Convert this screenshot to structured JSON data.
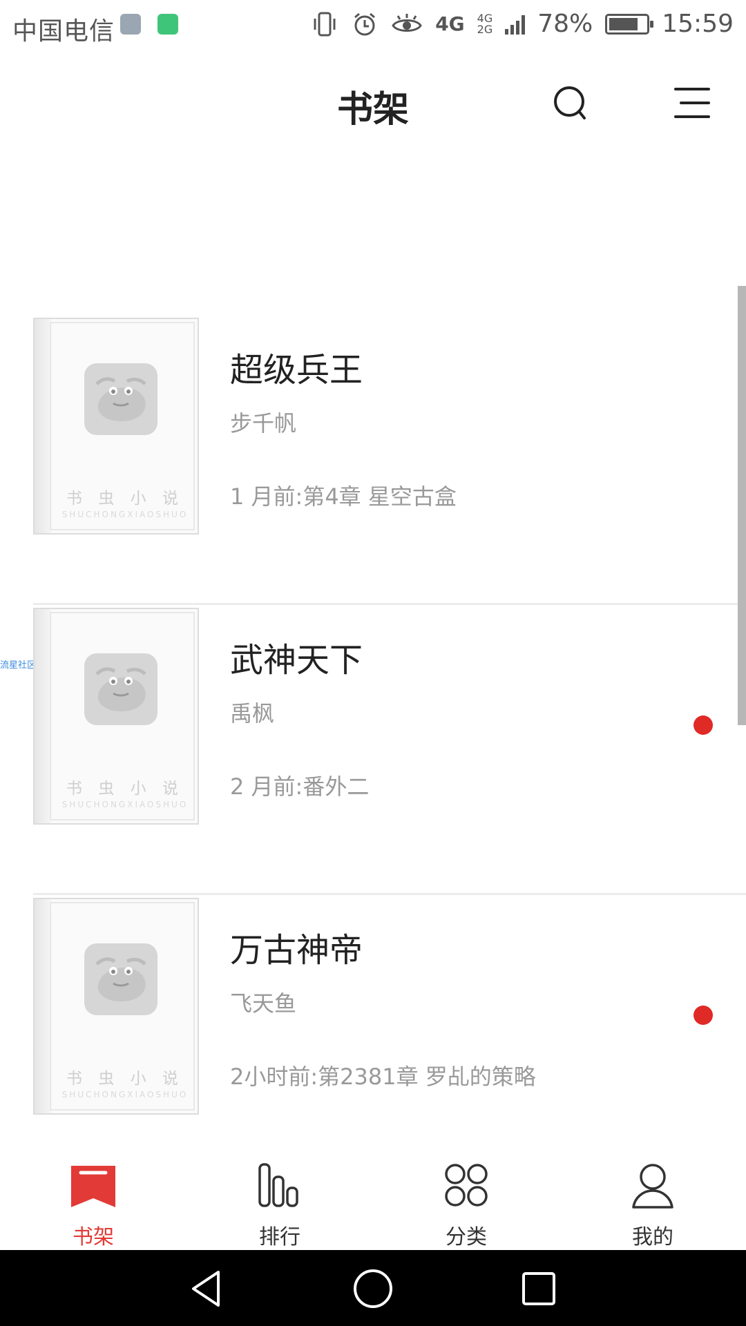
{
  "status_bar": {
    "carrier": "中国电信",
    "network_1": "4G",
    "network_2_top": "4G",
    "network_2_bottom": "2G",
    "battery_percent": "78%",
    "battery_level": 0.78,
    "time": "15:59"
  },
  "header": {
    "title": "书架",
    "search_icon": "search-icon",
    "menu_icon": "menu-icon"
  },
  "side_link": "流星社区",
  "cover": {
    "title_cn": "书 虫 小 说",
    "title_en": "SHUCHONGXIAOSHUO"
  },
  "books": [
    {
      "title": "超级兵王",
      "author": "步千帆",
      "update": "1 月前:第4章 星空古盒",
      "has_new": false
    },
    {
      "title": "武神天下",
      "author": "禹枫",
      "update": "2 月前:番外二",
      "has_new": true
    },
    {
      "title": "万古神帝",
      "author": "飞天鱼",
      "update": "2小时前:第2381章 罗乩的策略",
      "has_new": true
    }
  ],
  "tabs": [
    {
      "label": "书架",
      "icon": "bookshelf-icon",
      "active": true
    },
    {
      "label": "排行",
      "icon": "ranking-icon",
      "active": false
    },
    {
      "label": "分类",
      "icon": "category-icon",
      "active": false
    },
    {
      "label": "我的",
      "icon": "profile-icon",
      "active": false
    }
  ],
  "colors": {
    "accent": "#e23a36",
    "new_dot": "#e02a26",
    "secondary_text": "#999999"
  },
  "nav_icons": [
    "back-icon",
    "home-icon",
    "recents-icon"
  ]
}
